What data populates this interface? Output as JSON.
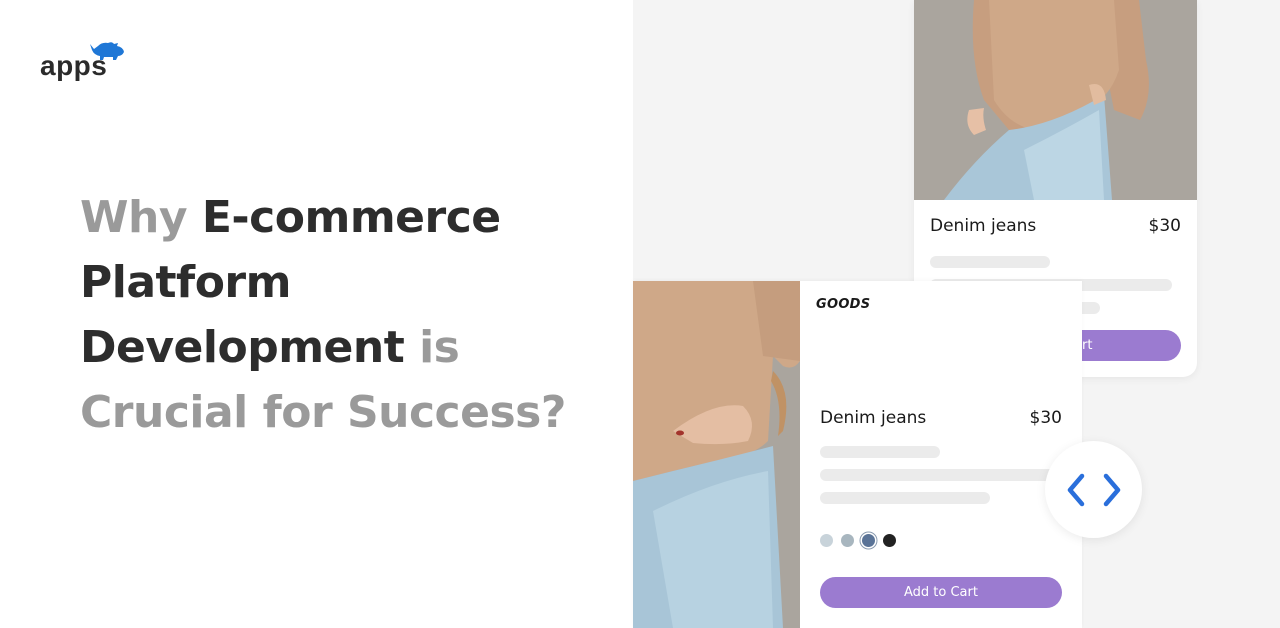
{
  "brand": {
    "logo_text": "apps",
    "logo_icon": "rhino-icon",
    "accent_color": "#1f77d6"
  },
  "headline": {
    "segments": [
      {
        "text": "Why ",
        "style": "muted"
      },
      {
        "text": "E-commerce",
        "style": "strong"
      },
      {
        "text": "Platform",
        "style": "strong"
      },
      {
        "text": "Development",
        "style": "strong"
      },
      {
        "text": " is",
        "style": "muted"
      },
      {
        "text": "Crucial for Success?",
        "style": "muted"
      }
    ],
    "muted_color": "#9a9a9a",
    "strong_color": "#2d2d2d"
  },
  "product_card_top": {
    "image": "model-beige-tshirt-denim-jeans",
    "name": "Denim jeans",
    "price": "$30",
    "button_label": "Add to Cart",
    "button_color": "#9b7bd0"
  },
  "product_card_bottom": {
    "image": "model-beige-tshirt-denim-jeans-closeup",
    "store_label": "GOODS",
    "name": "Denim jeans",
    "price": "$30",
    "swatches": [
      {
        "color": "#c8d3da",
        "selected": false
      },
      {
        "color": "#a8b6bf",
        "selected": false
      },
      {
        "color": "#5a7397",
        "selected": true
      },
      {
        "color": "#222222",
        "selected": false
      }
    ],
    "button_label": "Add to Cart",
    "button_color": "#9b7bd0"
  },
  "code_badge": {
    "icon": "code-brackets-icon",
    "color": "#2a6fdb"
  }
}
